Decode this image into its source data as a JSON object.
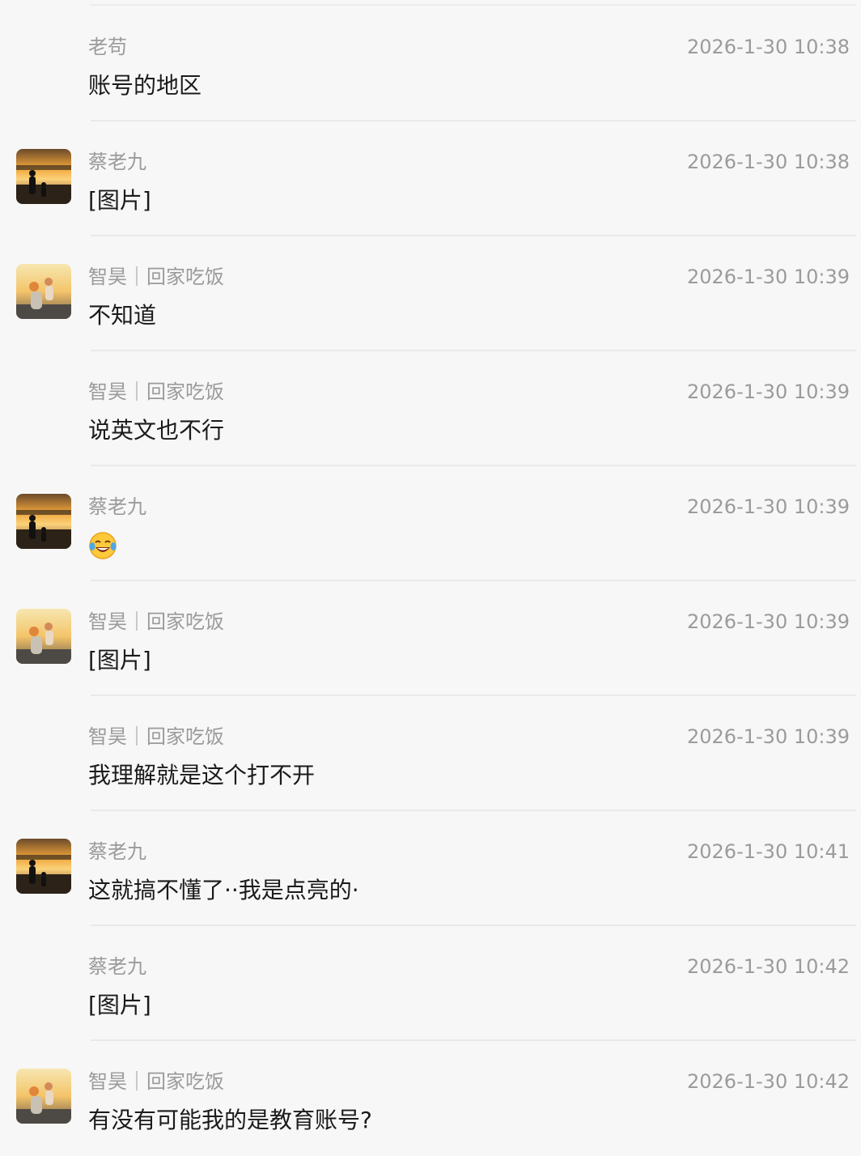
{
  "messages": [
    {
      "sender": "老苟",
      "time": "2026-1-30 10:38",
      "text": "账号的地区",
      "avatar": "none"
    },
    {
      "sender": "蔡老九",
      "time": "2026-1-30 10:38",
      "text": "[图片]",
      "avatar": "sunset-silhouette"
    },
    {
      "sender": "智昊｜回家吃饭",
      "time": "2026-1-30 10:39",
      "text": "不知道",
      "avatar": "sunset-child"
    },
    {
      "sender": "智昊｜回家吃饭",
      "time": "2026-1-30 10:39",
      "text": "说英文也不行",
      "avatar": "none"
    },
    {
      "sender": "蔡老九",
      "time": "2026-1-30 10:39",
      "text": "",
      "emoji": "laughing-crying-emoji",
      "avatar": "sunset-silhouette"
    },
    {
      "sender": "智昊｜回家吃饭",
      "time": "2026-1-30 10:39",
      "text": "[图片]",
      "avatar": "sunset-child"
    },
    {
      "sender": "智昊｜回家吃饭",
      "time": "2026-1-30 10:39",
      "text": "我理解就是这个打不开",
      "avatar": "none"
    },
    {
      "sender": "蔡老九",
      "time": "2026-1-30 10:41",
      "text": "这就搞不懂了··我是点亮的·",
      "avatar": "sunset-silhouette"
    },
    {
      "sender": "蔡老九",
      "time": "2026-1-30 10:42",
      "text": "[图片]",
      "avatar": "none"
    },
    {
      "sender": "智昊｜回家吃饭",
      "time": "2026-1-30 10:42",
      "text": "有没有可能我的是教育账号?",
      "avatar": "sunset-child"
    }
  ]
}
